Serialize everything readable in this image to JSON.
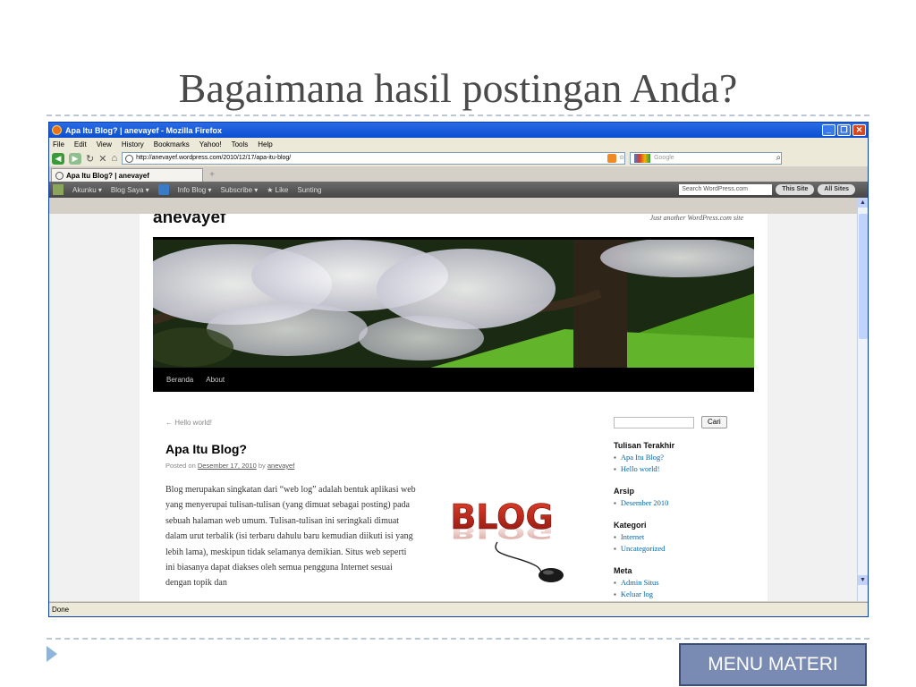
{
  "slide": {
    "title": "Bagaimana hasil postingan Anda?",
    "menu_button": "MENU MATERI"
  },
  "browser": {
    "window_title": "Apa Itu Blog? | anevayef - Mozilla Firefox",
    "menu": [
      "File",
      "Edit",
      "View",
      "History",
      "Bookmarks",
      "Yahoo!",
      "Tools",
      "Help"
    ],
    "url": "http://anevayef.wordpress.com/2010/12/17/apa-itu-blog/",
    "search_placeholder": "Google",
    "tab_title": "Apa Itu Blog? | anevayef",
    "new_tab": "+",
    "status": "Done"
  },
  "wp_admin_bar": {
    "items": [
      "Akunku ▾",
      "Blog Saya ▾",
      "Info Blog ▾",
      "Subscribe ▾",
      "★ Like",
      "Sunting"
    ],
    "search_placeholder": "Search WordPress.com",
    "this_site": "This Site",
    "all_sites": "All Sites"
  },
  "blog": {
    "site_title": "anevayef",
    "site_description": "Just another WordPress.com site",
    "menu": [
      "Beranda",
      "About"
    ],
    "nav_previous": "← Hello world!",
    "post_title": "Apa Itu Blog?",
    "meta_posted_on": "Posted on",
    "meta_date": "Desember 17, 2010",
    "meta_by": "by",
    "meta_author": "anevayef",
    "body": "Blog merupakan singkatan dari “web log” adalah bentuk aplikasi web yang menyerupai tulisan-tulisan (yang dimuat sebagai posting) pada sebuah halaman web umum. Tulisan-tulisan ini seringkali dimuat dalam urut terbalik (isi terbaru dahulu baru kemudian diikuti isi yang lebih lama), meskipun tidak selamanya demikian. Situs web seperti ini biasanya dapat diakses oleh semua pengguna Internet sesuai dengan topik dan",
    "image_text": "BLOG"
  },
  "sidebar": {
    "search_button": "Cari",
    "sections": [
      {
        "heading": "Tulisan Terakhir",
        "items": [
          "Apa Itu Blog?",
          "Hello world!"
        ]
      },
      {
        "heading": "Arsip",
        "items": [
          "Desember 2010"
        ]
      },
      {
        "heading": "Kategori",
        "items": [
          "Internet",
          "Uncategorized"
        ]
      },
      {
        "heading": "Meta",
        "items": [
          "Admin Situs",
          "Keluar log"
        ]
      }
    ]
  }
}
